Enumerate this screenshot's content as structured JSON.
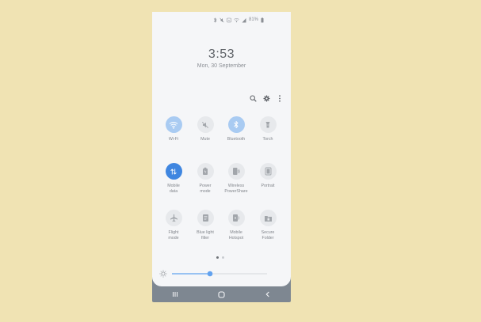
{
  "status_bar": {
    "battery_percent": "81%",
    "icons": [
      "bluetooth-icon",
      "mute-icon",
      "nfc-icon",
      "wifi-icon",
      "signal-icon",
      "battery-icon"
    ]
  },
  "header": {
    "time": "3:53",
    "date": "Mon, 30 September"
  },
  "toolbar": {
    "icons": [
      "search-icon",
      "gear-icon",
      "more-vertical-icon"
    ]
  },
  "quick_settings": {
    "page_index": 1,
    "page_count": 2,
    "tiles": [
      {
        "label": "Wi-Fi",
        "icon": "wifi-icon",
        "state": "on"
      },
      {
        "label": "Mute",
        "icon": "mute-icon",
        "state": "off"
      },
      {
        "label": "Bluetooth",
        "icon": "bluetooth-icon",
        "state": "on"
      },
      {
        "label": "Torch",
        "icon": "torch-icon",
        "state": "off"
      },
      {
        "label": "Mobile\ndata",
        "icon": "mobile-data-icon",
        "state": "active"
      },
      {
        "label": "Power\nmode",
        "icon": "power-mode-icon",
        "state": "off"
      },
      {
        "label": "Wireless\nPowerShare",
        "icon": "wireless-powershare-icon",
        "state": "off"
      },
      {
        "label": "Portrait",
        "icon": "portrait-icon",
        "state": "off"
      },
      {
        "label": "Flight\nmode",
        "icon": "airplane-icon",
        "state": "off"
      },
      {
        "label": "Blue light\nfilter",
        "icon": "blue-light-filter-icon",
        "state": "off"
      },
      {
        "label": "Mobile\nHotspot",
        "icon": "hotspot-icon",
        "state": "off"
      },
      {
        "label": "Secure\nFolder",
        "icon": "secure-folder-icon",
        "state": "off"
      }
    ]
  },
  "brightness": {
    "icon": "brightness-icon",
    "level": 0.4
  },
  "nav_bar": {
    "icons": [
      "recents-icon",
      "home-icon",
      "back-icon"
    ]
  },
  "colors": {
    "accent": "#3f86e0",
    "tile_on": "#a9cbf2",
    "tile_off": "#e7e9ec",
    "background": "#f0e3b3",
    "nav_bar": "#7e8791"
  }
}
